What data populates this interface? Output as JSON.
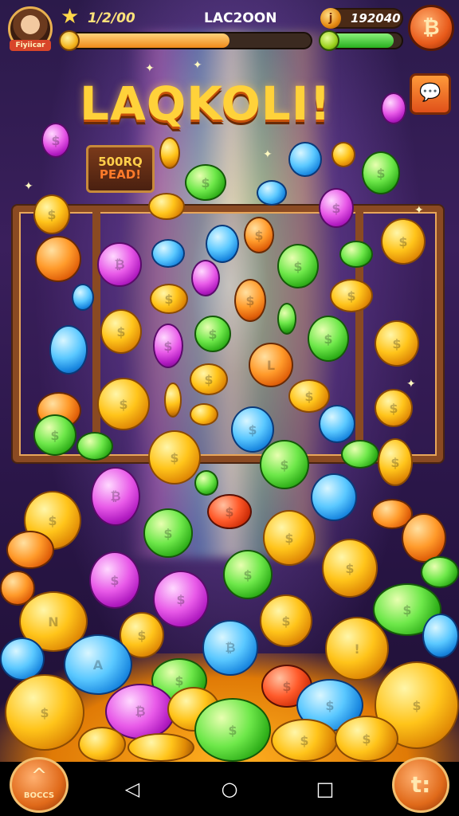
{
  "header": {
    "avatar_tag": "Fiyiicar",
    "score": "1/2/00",
    "title": "LAC2OON",
    "progress_fraction": 0.67,
    "coin_icon": "j",
    "coin_value": "192040",
    "energy_fraction": 0.9
  },
  "game": {
    "logo_text": "LAQKOLI!",
    "badge_line1": "500RQ",
    "badge_line2": "PEAD!"
  },
  "bottom": {
    "left_label": "BOCCS",
    "right_glyph": "t:",
    "shop_glyph": "₿"
  },
  "icons": {
    "star": "star-icon",
    "back": "back-icon",
    "home": "home-icon",
    "recents": "recents-icon",
    "chat": "chat-icon"
  },
  "colors": {
    "gold": "#ffc41a",
    "green": "#6ee84a",
    "blue": "#5ac8ff",
    "pink": "#e85ae8",
    "orange": "#ff9a2a"
  }
}
